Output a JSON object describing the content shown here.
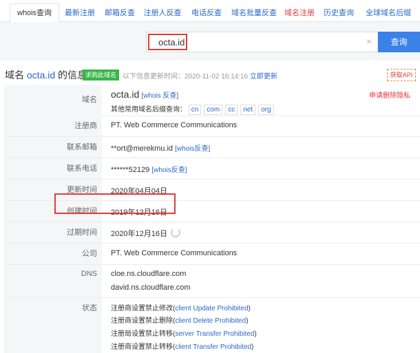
{
  "tabs": [
    {
      "label": "whois查询"
    },
    {
      "label": "最新注册"
    },
    {
      "label": "邮箱反查"
    },
    {
      "label": "注册人反查"
    },
    {
      "label": "电话反查"
    },
    {
      "label": "域名批量反查"
    },
    {
      "label": "域名注册"
    },
    {
      "label": "历史查询"
    },
    {
      "label": "全球域名后缀"
    }
  ],
  "search": {
    "value": "octa.id",
    "button": "查询",
    "clear": "×"
  },
  "info": {
    "title_prefix": "域名 ",
    "domain": "octa.id",
    "title_suffix": " 的信息",
    "buy_badge": "求购此域名",
    "update_text": "以下信息更新时间：2020-11-02 16:14:16",
    "update_link": "立即更新",
    "api_badge": "获取API"
  },
  "rows": {
    "domain": {
      "label": "域名",
      "name": "octa.id",
      "whois_link": "[whois 反查]",
      "privacy": "申请删除隐私",
      "suffix_label": "其他常用域名后缀查询：",
      "suffixes": [
        "cn",
        "com",
        "cc",
        "net",
        "org"
      ]
    },
    "registrar": {
      "label": "注册商",
      "value": "PT. Web Commerce Communications"
    },
    "email": {
      "label": "联系邮箱",
      "value": "**ort@merekmu.id",
      "link": "[whois反查]"
    },
    "phone": {
      "label": "联系电话",
      "value": "******52129",
      "link": "[whois反查]"
    },
    "updated": {
      "label": "更新时间",
      "value": "2020年04月04日"
    },
    "created": {
      "label": "创建时间",
      "value": "2019年12月16日"
    },
    "expires": {
      "label": "过期时间",
      "value": "2020年12月16日"
    },
    "company": {
      "label": "公司",
      "value": "PT. Web Commerce Communications"
    },
    "dns": {
      "label": "DNS",
      "values": [
        "cloe.ns.cloudflare.com",
        "david.ns.cloudflare.com"
      ]
    },
    "status": {
      "label": "状态",
      "items": [
        {
          "prefix": "注册商设置禁止修改(",
          "link": "client Update Prohibited",
          "suffix": ")"
        },
        {
          "prefix": "注册商设置禁止删除(",
          "link": "client Delete Prohibited",
          "suffix": ")"
        },
        {
          "prefix": "注册局设置禁止转移(",
          "link": "server Transfer Prohibited",
          "suffix": ")"
        },
        {
          "prefix": "注册商设置禁止转移(",
          "link": "client Transfer Prohibited",
          "suffix": ")"
        }
      ]
    }
  },
  "colors": {
    "accent": "#3a82e8",
    "link": "#2a66c9",
    "highlight": "#e23b3b",
    "badge_green": "#3bb54a"
  }
}
